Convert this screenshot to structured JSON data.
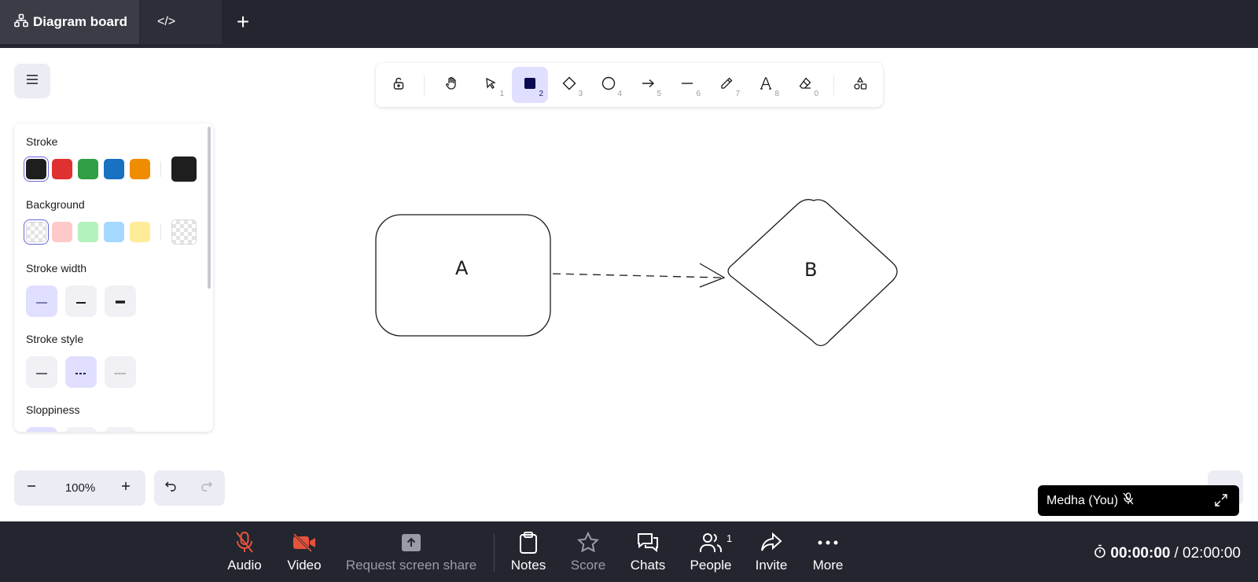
{
  "tabs": {
    "diagram_label": "Diagram board",
    "code_label": "</>",
    "add_label": "+"
  },
  "toolbar": {
    "tools": [
      {
        "name": "lock",
        "key": ""
      },
      {
        "name": "hand",
        "key": ""
      },
      {
        "name": "selection",
        "key": "1"
      },
      {
        "name": "rectangle",
        "key": "2",
        "active": true
      },
      {
        "name": "diamond",
        "key": "3"
      },
      {
        "name": "ellipse",
        "key": "4"
      },
      {
        "name": "arrow",
        "key": "5"
      },
      {
        "name": "line",
        "key": "6"
      },
      {
        "name": "draw",
        "key": "7"
      },
      {
        "name": "text",
        "key": "8"
      },
      {
        "name": "eraser",
        "key": "0"
      },
      {
        "name": "extra-shapes",
        "key": ""
      }
    ]
  },
  "props": {
    "stroke_label": "Stroke",
    "background_label": "Background",
    "stroke_width_label": "Stroke width",
    "stroke_style_label": "Stroke style",
    "sloppiness_label": "Sloppiness",
    "stroke_colors": [
      "#1e1e1e",
      "#e03131",
      "#2f9e44",
      "#1971c2",
      "#f08c00"
    ],
    "stroke_current": "#1e1e1e",
    "background_colors": [
      "transparent",
      "#ffc9c9",
      "#b2f2bb",
      "#a5d8ff",
      "#ffec99"
    ],
    "background_current": "transparent"
  },
  "canvas": {
    "shape_a_label": "A",
    "shape_b_label": "B"
  },
  "zoom": {
    "value": "100%"
  },
  "self_tile": {
    "name": "Medha (You)"
  },
  "callbar": {
    "audio_label": "Audio",
    "video_label": "Video",
    "screen_share_label": "Request screen share",
    "notes_label": "Notes",
    "score_label": "Score",
    "chats_label": "Chats",
    "people_label": "People",
    "people_count": "1",
    "invite_label": "Invite",
    "more_label": "More",
    "timer_elapsed": "00:00:00",
    "timer_total": "/ 02:00:00",
    "muted_color": "#e5533d"
  }
}
